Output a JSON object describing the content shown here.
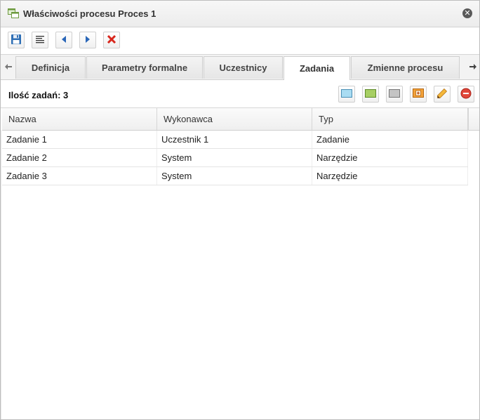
{
  "window": {
    "title": "Właściwości procesu Proces 1",
    "icons": {
      "app": "process-windows-icon",
      "close": "close-circle-icon"
    }
  },
  "toolbar": {
    "buttons": [
      {
        "name": "save-button",
        "icon": "floppy-disk-icon"
      },
      {
        "name": "properties-button",
        "icon": "list-lines-icon"
      },
      {
        "name": "previous-button",
        "icon": "arrow-left-icon"
      },
      {
        "name": "next-button",
        "icon": "arrow-right-icon"
      },
      {
        "name": "delete-button",
        "icon": "red-x-icon"
      }
    ]
  },
  "tabs": {
    "items": [
      {
        "label": "Definicja"
      },
      {
        "label": "Parametry formalne"
      },
      {
        "label": "Uczestnicy"
      },
      {
        "label": "Zadania"
      },
      {
        "label": "Zmienne procesu"
      }
    ],
    "active": "Zadania",
    "scroll_left_icon": "arrow-left-icon",
    "scroll_right_icon": "arrow-right-icon"
  },
  "tasks": {
    "count_label": "Ilość zadań: 3",
    "actions": [
      {
        "name": "add-task-blue-button",
        "icon": "blue-rectangle-icon",
        "color": "#a9dcf2"
      },
      {
        "name": "add-task-green-button",
        "icon": "green-rectangle-icon",
        "color": "#a7cf63"
      },
      {
        "name": "add-task-gray-button",
        "icon": "gray-rectangle-icon",
        "color": "#c4c4c4"
      },
      {
        "name": "add-subprocess-button",
        "icon": "orange-plus-box-icon",
        "color": "#f3a23a"
      },
      {
        "name": "edit-task-button",
        "icon": "pencil-icon",
        "color": "#f4b73a"
      },
      {
        "name": "remove-task-button",
        "icon": "red-minus-circle-icon",
        "color": "#e0473a"
      }
    ]
  },
  "table": {
    "columns": [
      "Nazwa",
      "Wykonawca",
      "Typ"
    ],
    "rows": [
      [
        "Zadanie 1",
        "Uczestnik 1",
        "Zadanie"
      ],
      [
        "Zadanie 2",
        "System",
        "Narzędzie"
      ],
      [
        "Zadanie 3",
        "System",
        "Narzędzie"
      ]
    ]
  }
}
